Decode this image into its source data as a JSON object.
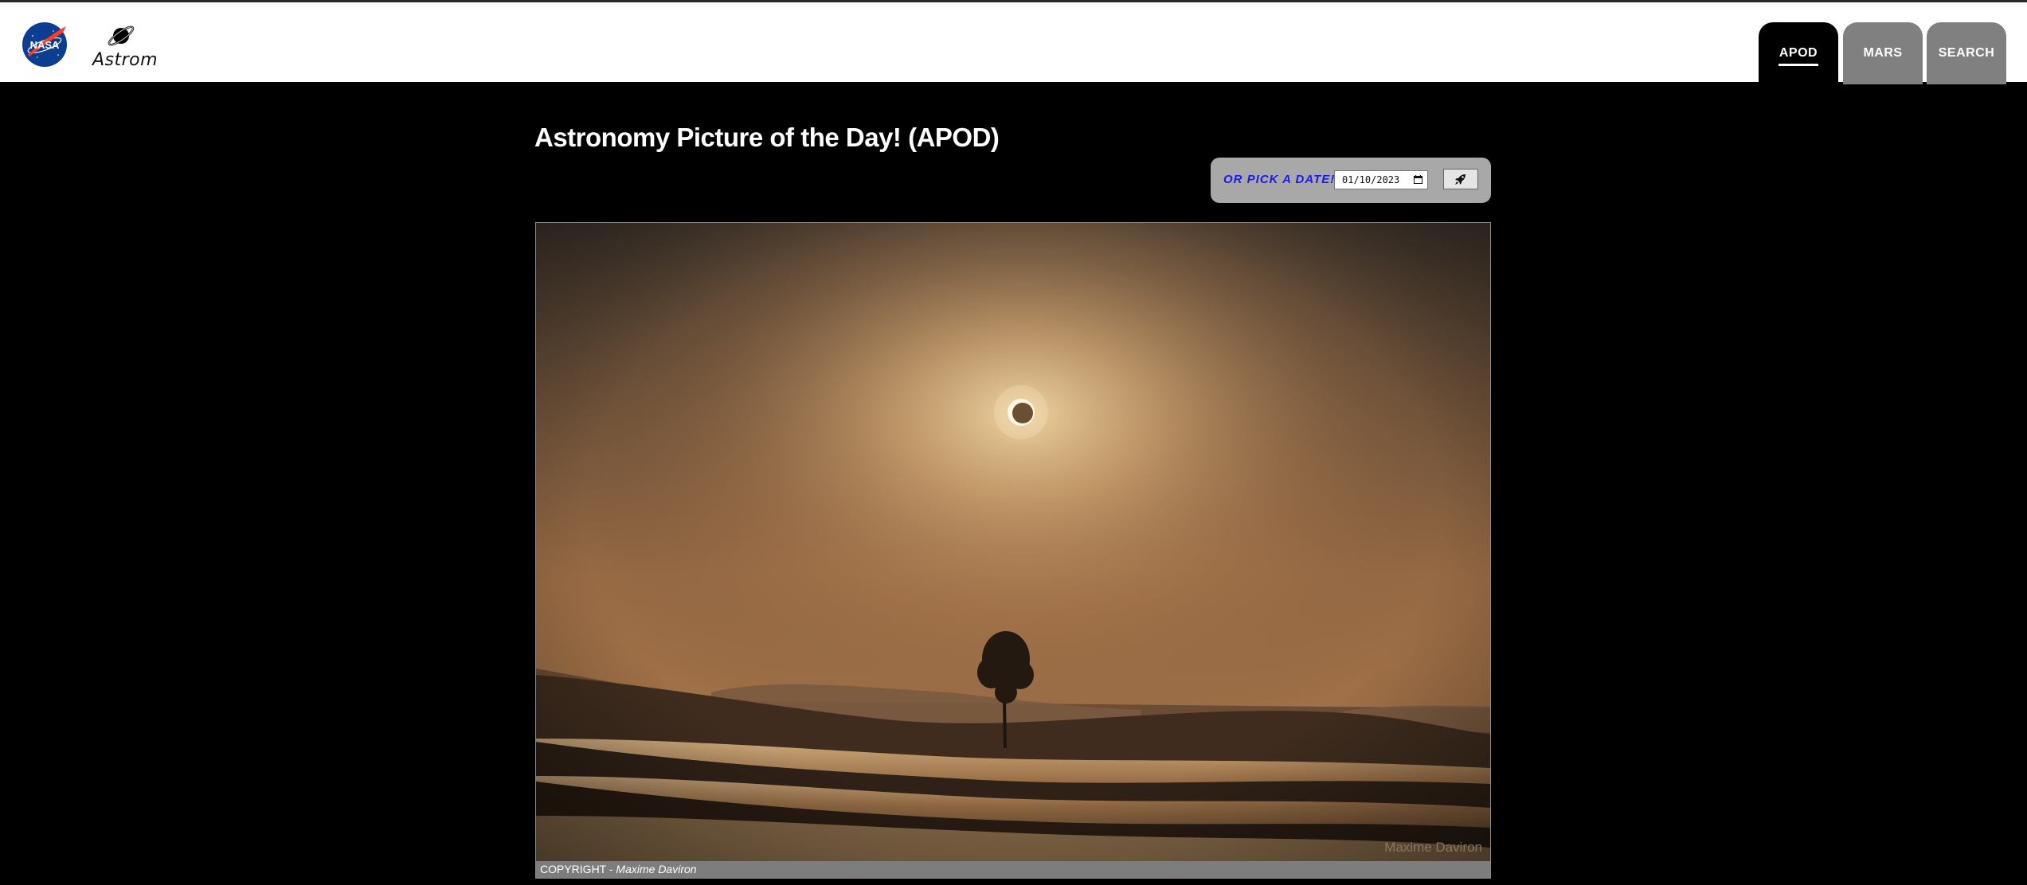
{
  "header": {
    "nasa_logo_text": "NASA",
    "brand_name": "Astrom"
  },
  "nav": {
    "tabs": [
      {
        "label": "APOD",
        "active": true
      },
      {
        "label": "MARS",
        "active": false
      },
      {
        "label": "SEARCH",
        "active": false
      }
    ]
  },
  "main": {
    "title": "Astronomy Picture of the Day! (APOD)",
    "date_picker": {
      "label": "OR PICK A DATE!",
      "value": "01/10/2023",
      "submit_icon": "rocket-icon"
    },
    "image": {
      "watermark": "Maxime Daviron",
      "copyright_label": "COPYRIGHT -",
      "copyright_name": "Maxime Daviron"
    }
  },
  "colors": {
    "background": "#000000",
    "header_bg": "#ffffff",
    "tab_active": "#000000",
    "tab_inactive": "#808080",
    "date_panel": "#a8a8a8",
    "pick_label": "#1a1aee"
  }
}
